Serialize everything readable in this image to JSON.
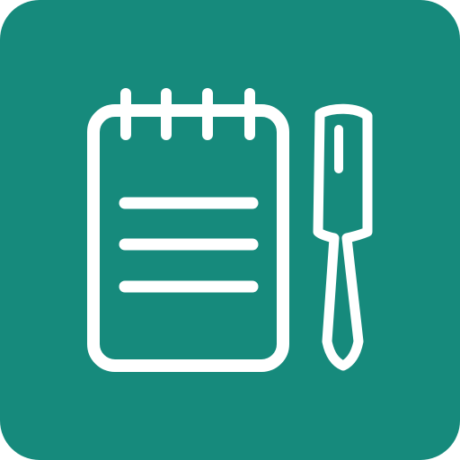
{
  "icon": {
    "name": "notes-app-icon",
    "glyphs": [
      "notepad-icon",
      "pen-icon"
    ],
    "colors": {
      "background": "#168A7C",
      "stroke": "#FFFFFF"
    }
  }
}
